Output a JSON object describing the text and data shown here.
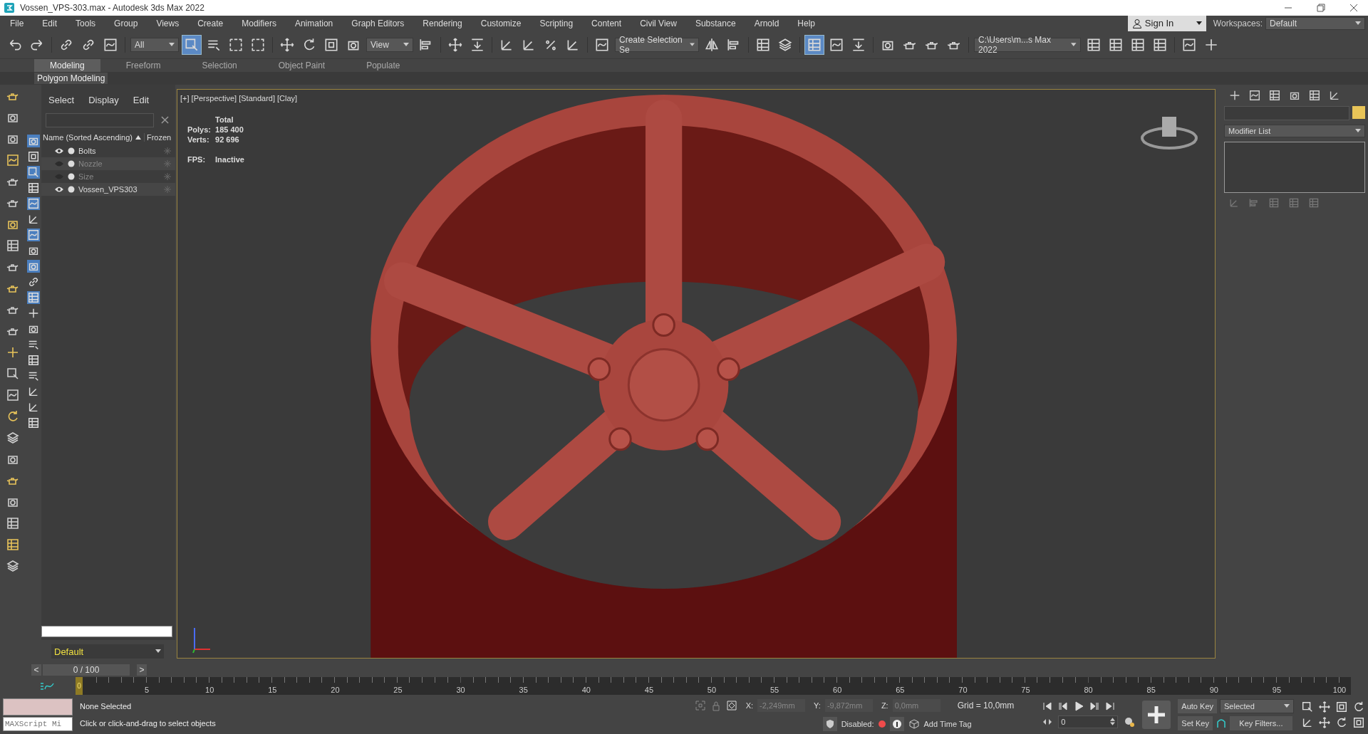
{
  "window": {
    "title": "Vossen_VPS-303.max - Autodesk 3ds Max 2022"
  },
  "menu": [
    "File",
    "Edit",
    "Tools",
    "Group",
    "Views",
    "Create",
    "Modifiers",
    "Animation",
    "Graph Editors",
    "Rendering",
    "Customize",
    "Scripting",
    "Content",
    "Civil View",
    "Substance",
    "Arnold",
    "Help"
  ],
  "account": {
    "sign_in": "Sign In",
    "workspaces_label": "Workspaces:",
    "workspace": "Default"
  },
  "toolbar": {
    "selection_filter": "All",
    "reference_coord": "View",
    "named_selection": "Create Selection Se",
    "project_folder": "C:\\Users\\m...s Max 2022"
  },
  "ribbon": {
    "tabs": [
      {
        "label": "Modeling",
        "selected": true
      },
      {
        "label": "Freeform",
        "selected": false
      },
      {
        "label": "Selection",
        "selected": false
      },
      {
        "label": "Object Paint",
        "selected": false
      },
      {
        "label": "Populate",
        "selected": false
      }
    ],
    "panel": "Polygon Modeling"
  },
  "scene_explorer": {
    "menu": [
      "Select",
      "Display",
      "Edit"
    ],
    "columns": [
      "Name (Sorted Ascending)",
      "Frozen"
    ],
    "rows": [
      {
        "name": "Bolts",
        "visible": true
      },
      {
        "name": "Nozzle",
        "visible": false
      },
      {
        "name": "Size",
        "visible": false
      },
      {
        "name": "Vossen_VPS303",
        "visible": true
      }
    ],
    "layer": "Default"
  },
  "viewport": {
    "label": "[+] [Perspective] [Standard] [Clay]",
    "stats": {
      "header": "Total",
      "rows": [
        {
          "label": "Polys:",
          "value": "185 400"
        },
        {
          "label": "Verts:",
          "value": "92 696"
        }
      ],
      "fps_label": "FPS:",
      "fps": "Inactive"
    }
  },
  "command_panel": {
    "modifier_list": "Modifier List"
  },
  "time_slider": {
    "frame": "0 / 100",
    "level": 0,
    "prev": "<",
    "next": ">"
  },
  "track_bar": {
    "current": "0",
    "labels": [
      "5",
      "10",
      "15",
      "20",
      "25",
      "30",
      "35",
      "40",
      "45",
      "50",
      "55",
      "60",
      "65",
      "70",
      "75",
      "80",
      "85",
      "90",
      "95",
      "100"
    ]
  },
  "status": {
    "selection": "None Selected",
    "prompt": "Click or click-and-drag to select objects",
    "maxscript": {
      "placeholder": "MAXScript Mi"
    },
    "coords": [
      {
        "label": "X:",
        "value": "-2,249mm"
      },
      {
        "label": "Y:",
        "value": "-9,872mm"
      },
      {
        "label": "Z:",
        "value": "0,0mm"
      }
    ],
    "grid": "Grid = 10,0mm",
    "adaptive_label": "Disabled:",
    "time_tag": "Add Time Tag",
    "frame": "0",
    "auto_key": "Auto Key",
    "key_mode": "Selected",
    "set_key": "Set Key",
    "key_filters": "Key Filters..."
  }
}
